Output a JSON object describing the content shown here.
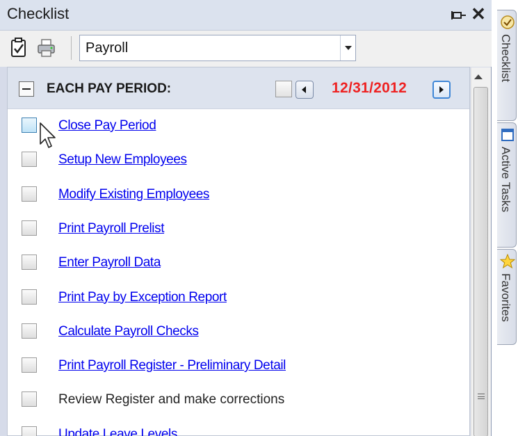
{
  "window": {
    "title": "Checklist",
    "pin_glyph": "⊣",
    "close_glyph": "✕"
  },
  "toolbar": {
    "checklist_icon": "checklist-icon",
    "print_icon": "printer-icon",
    "dropdown_value": "Payroll"
  },
  "section": {
    "title": "EACH PAY PERIOD:",
    "date": "12/31/2012",
    "date_color": "#ee2222",
    "collapsed": false
  },
  "items": [
    {
      "label": "Close Pay Period",
      "link": true,
      "checked": false
    },
    {
      "label": "Setup New Employees",
      "link": true,
      "checked": false
    },
    {
      "label": "Modify Existing Employees",
      "link": true,
      "checked": false
    },
    {
      "label": "Print Payroll Prelist",
      "link": true,
      "checked": false
    },
    {
      "label": "Enter Payroll Data",
      "link": true,
      "checked": false
    },
    {
      "label": "Print Pay by Exception Report",
      "link": true,
      "checked": false
    },
    {
      "label": "Calculate Payroll Checks",
      "link": true,
      "checked": false
    },
    {
      "label": "Print Payroll Register - Preliminary Detail",
      "link": true,
      "checked": false
    },
    {
      "label": "Review Register and make corrections",
      "link": false,
      "checked": false
    },
    {
      "label": "Update Leave Levels",
      "link": true,
      "checked": false
    }
  ],
  "side_tabs": [
    {
      "label": "Checklist",
      "icon": "checklist-tab-icon"
    },
    {
      "label": "Active Tasks",
      "icon": "tasks-tab-icon"
    },
    {
      "label": "Favorites",
      "icon": "star-icon"
    }
  ],
  "colors": {
    "link": "#0000ee",
    "accent": "#3e86d6",
    "header_band": "#dde3ee"
  }
}
